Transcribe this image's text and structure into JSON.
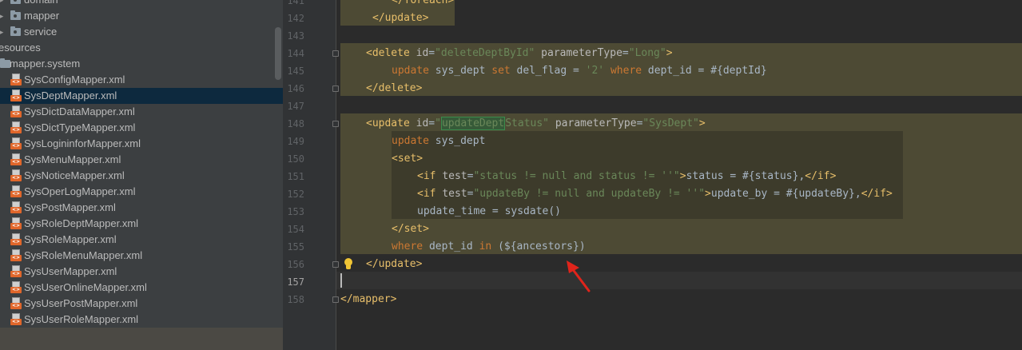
{
  "project_tree": {
    "items": [
      {
        "label": "domain",
        "kind": "package",
        "depth": 0
      },
      {
        "label": "mapper",
        "kind": "package",
        "depth": 0
      },
      {
        "label": "service",
        "kind": "package",
        "depth": 0
      },
      {
        "label": "esources",
        "kind": "root",
        "depth": 0
      },
      {
        "label": "mapper.system",
        "kind": "folder",
        "depth": 0
      },
      {
        "label": "SysConfigMapper.xml",
        "kind": "xml"
      },
      {
        "label": "SysDeptMapper.xml",
        "kind": "xml",
        "selected": true
      },
      {
        "label": "SysDictDataMapper.xml",
        "kind": "xml"
      },
      {
        "label": "SysDictTypeMapper.xml",
        "kind": "xml"
      },
      {
        "label": "SysLogininforMapper.xml",
        "kind": "xml"
      },
      {
        "label": "SysMenuMapper.xml",
        "kind": "xml"
      },
      {
        "label": "SysNoticeMapper.xml",
        "kind": "xml"
      },
      {
        "label": "SysOperLogMapper.xml",
        "kind": "xml"
      },
      {
        "label": "SysPostMapper.xml",
        "kind": "xml"
      },
      {
        "label": "SysRoleDeptMapper.xml",
        "kind": "xml"
      },
      {
        "label": "SysRoleMapper.xml",
        "kind": "xml"
      },
      {
        "label": "SysRoleMenuMapper.xml",
        "kind": "xml"
      },
      {
        "label": "SysUserMapper.xml",
        "kind": "xml"
      },
      {
        "label": "SysUserOnlineMapper.xml",
        "kind": "xml"
      },
      {
        "label": "SysUserPostMapper.xml",
        "kind": "xml"
      },
      {
        "label": "SysUserRoleMapper.xml",
        "kind": "xml"
      }
    ],
    "xml_badge": "<>"
  },
  "editor": {
    "current_line": "157",
    "lines": [
      {
        "n": "141",
        "tokens": [
          [
            "t",
            "</foreach>"
          ]
        ]
      },
      {
        "n": "142",
        "tokens": [
          [
            "t",
            "</update>"
          ]
        ]
      },
      {
        "n": "143",
        "tokens": []
      },
      {
        "n": "144",
        "tokens": [
          [
            "t",
            "<delete "
          ],
          [
            "a",
            "id"
          ],
          [
            "i",
            "="
          ],
          [
            "v",
            "\"deleteDeptById\""
          ],
          [
            "a",
            " parameterType"
          ],
          [
            "i",
            "="
          ],
          [
            "v",
            "\"Long\""
          ],
          [
            "t",
            ">"
          ]
        ]
      },
      {
        "n": "145",
        "tokens": [
          [
            "k",
            "update"
          ],
          [
            "i",
            " sys_dept "
          ],
          [
            "k",
            "set"
          ],
          [
            "i",
            " del_flag = "
          ],
          [
            "v",
            "'2'"
          ],
          [
            "i",
            " "
          ],
          [
            "k",
            "where"
          ],
          [
            "i",
            " dept_id = #{deptId}"
          ]
        ]
      },
      {
        "n": "146",
        "tokens": [
          [
            "t",
            "</delete>"
          ]
        ]
      },
      {
        "n": "147",
        "tokens": []
      },
      {
        "n": "148",
        "tokens": [
          [
            "t",
            "<update "
          ],
          [
            "a",
            "id"
          ],
          [
            "i",
            "="
          ],
          [
            "v",
            "\""
          ],
          [
            "vm",
            "updateDept"
          ],
          [
            "v",
            "Status\""
          ],
          [
            "a",
            " parameterType"
          ],
          [
            "i",
            "="
          ],
          [
            "v",
            "\"SysDept\""
          ],
          [
            "t",
            ">"
          ]
        ]
      },
      {
        "n": "149",
        "tokens": [
          [
            "k",
            "update"
          ],
          [
            "i",
            " sys_dept"
          ]
        ]
      },
      {
        "n": "150",
        "tokens": [
          [
            "t",
            "<set>"
          ]
        ]
      },
      {
        "n": "151",
        "tokens": [
          [
            "t",
            "<if "
          ],
          [
            "a",
            "test"
          ],
          [
            "i",
            "="
          ],
          [
            "v",
            "\"status != null and status != ''\""
          ],
          [
            "t",
            ">"
          ],
          [
            "i",
            "status = #{status},"
          ],
          [
            "t",
            "</if>"
          ]
        ]
      },
      {
        "n": "152",
        "tokens": [
          [
            "t",
            "<if "
          ],
          [
            "a",
            "test"
          ],
          [
            "i",
            "="
          ],
          [
            "v",
            "\"updateBy != null and updateBy != ''\""
          ],
          [
            "t",
            ">"
          ],
          [
            "i",
            "update_by = #{updateBy},"
          ],
          [
            "t",
            "</if>"
          ]
        ]
      },
      {
        "n": "153",
        "tokens": [
          [
            "i",
            "update_time = sysdate()"
          ]
        ]
      },
      {
        "n": "154",
        "tokens": [
          [
            "t",
            "</set>"
          ]
        ]
      },
      {
        "n": "155",
        "tokens": [
          [
            "k",
            "where"
          ],
          [
            "i",
            " dept_id "
          ],
          [
            "k",
            "in"
          ],
          [
            "i",
            " (${ancestors})"
          ]
        ]
      },
      {
        "n": "156",
        "tokens": [
          [
            "t",
            "</update>"
          ]
        ]
      },
      {
        "n": "157",
        "tokens": []
      },
      {
        "n": "158",
        "tokens": [
          [
            "t",
            "</mapper>"
          ]
        ]
      }
    ]
  },
  "colors": {
    "tag": "#e8bf6a",
    "attribute": "#bababa",
    "string": "#6a8759",
    "keyword": "#cc7832",
    "identifier": "#a9b7c6",
    "highlight": "#4d4a34",
    "annotation_arrow": "#e0241b"
  },
  "icons": [
    "folder-icon",
    "package-icon",
    "xml-file-icon",
    "intention-bulb-icon",
    "red-arrow-annotation",
    "fold-marker-icon"
  ]
}
